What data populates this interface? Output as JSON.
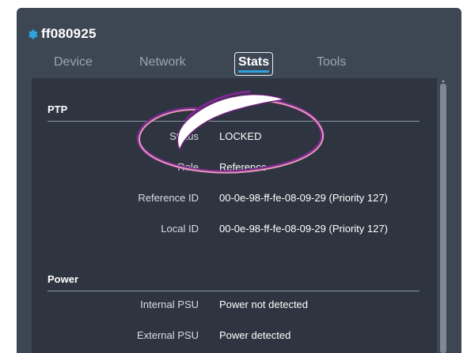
{
  "device": {
    "title": "ff080925",
    "icon": "gear-icon",
    "accent_color": "#2fa3dd"
  },
  "tabs": [
    {
      "label": "Device",
      "active": false
    },
    {
      "label": "Network",
      "active": false
    },
    {
      "label": "Stats",
      "active": true
    },
    {
      "label": "Tools",
      "active": false
    }
  ],
  "sections": {
    "ptp": {
      "title": "PTP",
      "rows": [
        {
          "label": "Status",
          "value": "LOCKED"
        },
        {
          "label": "Role",
          "value": "Reference"
        },
        {
          "label": "Reference ID",
          "value": "00-0e-98-ff-fe-08-09-29 (Priority 127)"
        },
        {
          "label": "Local ID",
          "value": "00-0e-98-ff-fe-08-09-29 (Priority 127)"
        }
      ]
    },
    "power": {
      "title": "Power",
      "rows": [
        {
          "label": "Internal PSU",
          "value": "Power not detected"
        },
        {
          "label": "External PSU",
          "value": "Power detected"
        }
      ]
    }
  },
  "annotation": {
    "color": "#7b2a8e"
  }
}
